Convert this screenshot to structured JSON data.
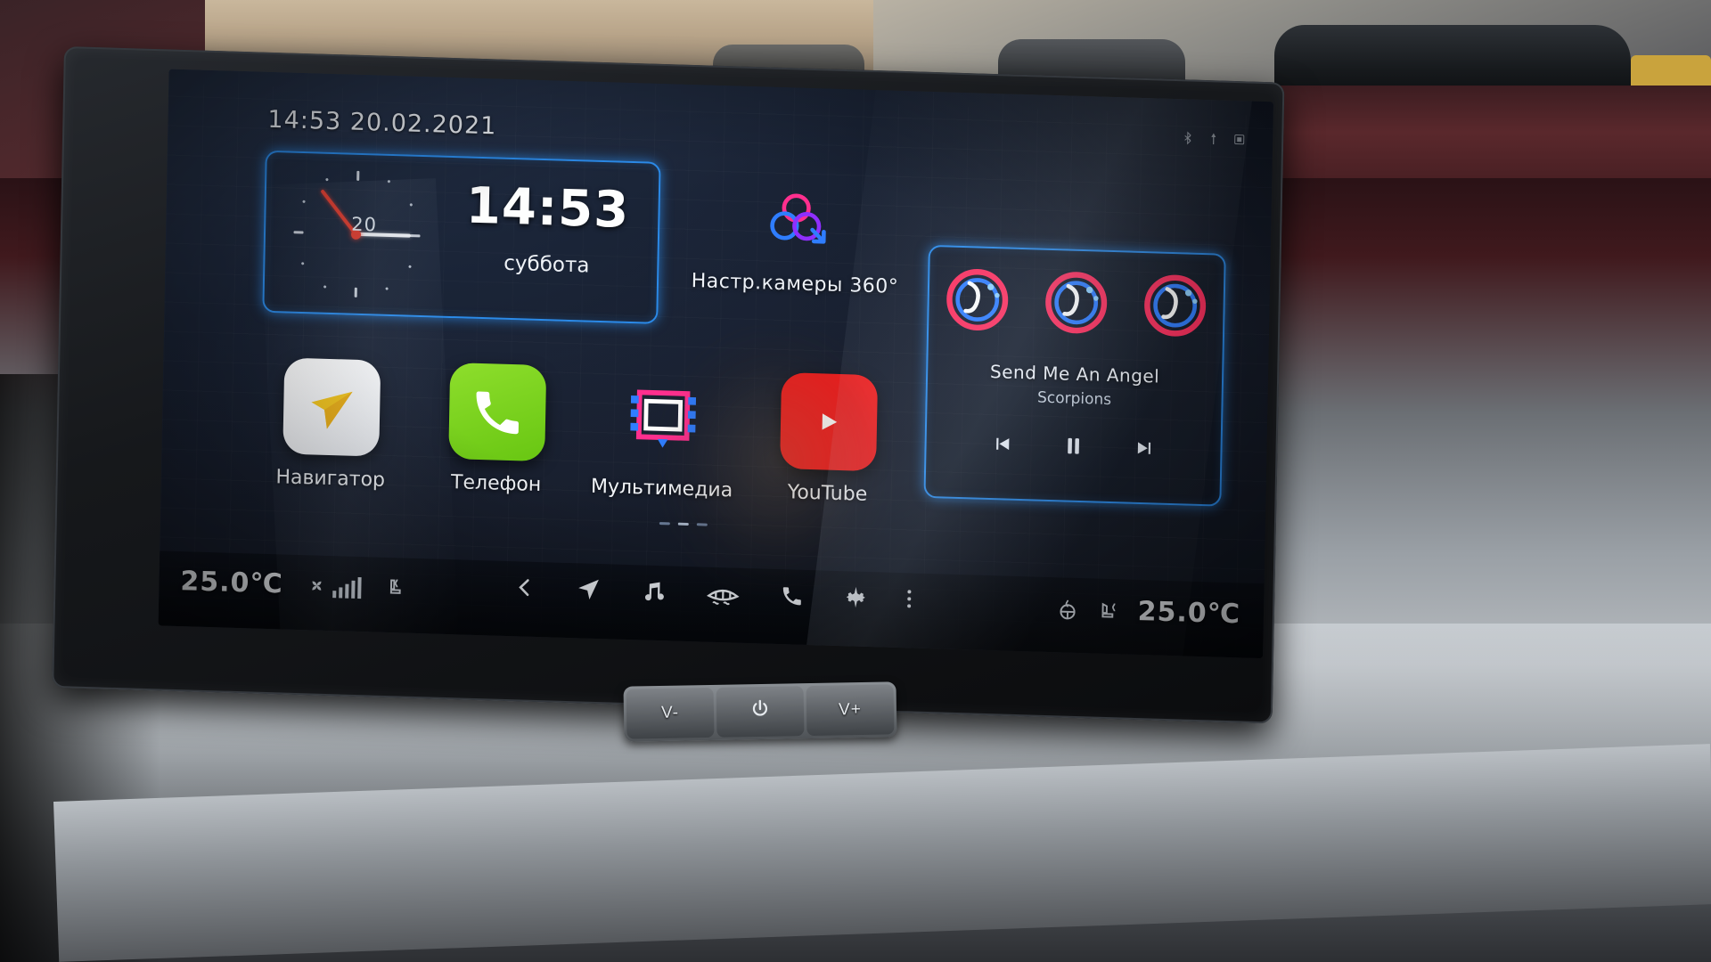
{
  "status_bar": {
    "time": "14:53",
    "date": "20.02.2021",
    "datetime_text": "14:53 20.02.2021",
    "icons": [
      "bluetooth-icon",
      "gps-icon",
      "sdcard-icon"
    ]
  },
  "clock_widget": {
    "digital_time": "14:53",
    "day_of_week": "суббота",
    "dial_number": "20",
    "accent_color": "#2b8ae8",
    "second_hand_color": "#e03c2e"
  },
  "camera_shortcut": {
    "label": "Настр.камеры 360°",
    "icon": "camera-360-icon"
  },
  "apps": [
    {
      "label": "Навигатор",
      "icon": "navigator-icon",
      "tile_color": "#ffffff"
    },
    {
      "label": "Телефон",
      "icon": "phone-icon",
      "tile_color": "#7ed321"
    },
    {
      "label": "Мультимедиа",
      "icon": "multimedia-icon",
      "tile_color": "#1a1a2b"
    },
    {
      "label": "YouTube",
      "icon": "youtube-icon",
      "tile_color": "#f21f1f"
    }
  ],
  "music_widget": {
    "title": "Send Me An Angel",
    "artist": "Scorpions",
    "album_art_icon": "saxophone-neon-icon",
    "controls": [
      {
        "name": "previous-track-button",
        "icon": "skip-back-icon"
      },
      {
        "name": "play-pause-button",
        "icon": "pause-icon"
      },
      {
        "name": "next-track-button",
        "icon": "skip-forward-icon"
      }
    ]
  },
  "bottom_bar": {
    "left_temperature": "25.0℃",
    "right_temperature": "25.0℃",
    "left_icons": [
      "fan-speed-icon",
      "seat-heater-left-icon"
    ],
    "right_icons": [
      "steering-wheel-heater-icon",
      "seat-heater-right-icon"
    ],
    "center_icons": [
      {
        "name": "back-button",
        "icon": "chevron-left-icon"
      },
      {
        "name": "navigation-button",
        "icon": "navigation-arrow-icon"
      },
      {
        "name": "music-button",
        "icon": "music-note-icon"
      },
      {
        "name": "defrost-button",
        "icon": "defrost-icon"
      },
      {
        "name": "phone-button",
        "icon": "phone-handset-icon"
      },
      {
        "name": "settings-button",
        "icon": "gear-icon"
      },
      {
        "name": "more-button",
        "icon": "more-vertical-icon"
      }
    ]
  },
  "page_indicator": {
    "pages": 3,
    "active": 1
  },
  "hardware_buttons": {
    "volume_down": "V-",
    "power": "power-icon",
    "volume_up": "V+"
  }
}
